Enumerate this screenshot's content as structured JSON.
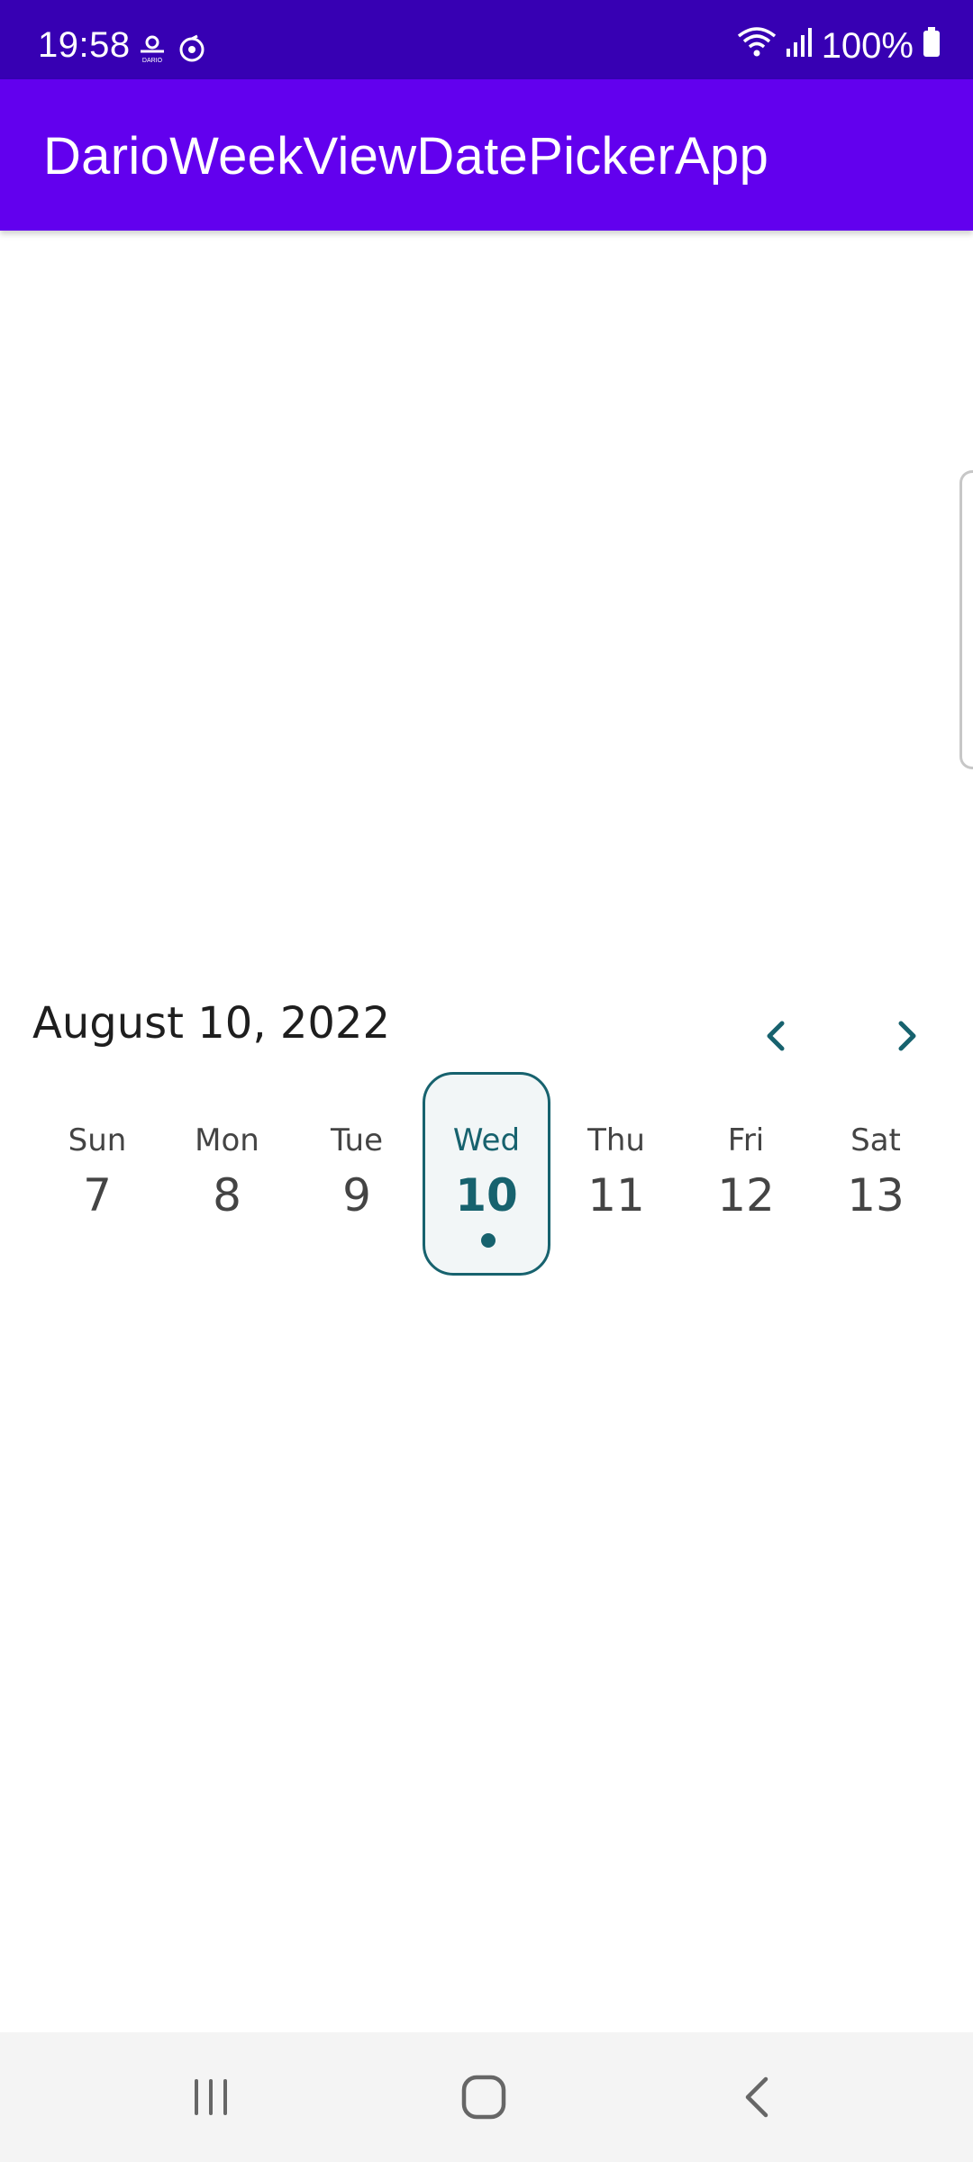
{
  "status_bar": {
    "time": "19:58",
    "notification_icons": [
      "dario-app-icon",
      "sync-icon"
    ],
    "battery_text": "100%",
    "right_icons": [
      "wifi-icon",
      "signal-icon",
      "battery-icon"
    ]
  },
  "app_bar": {
    "title": "DarioWeekViewDatePickerApp"
  },
  "week_picker": {
    "selected_date_label": "August 10, 2022",
    "prev_icon": "chevron-left-icon",
    "next_icon": "chevron-right-icon",
    "accent_color": "#17626e",
    "days": [
      {
        "name": "Sun",
        "number": "7",
        "selected": false
      },
      {
        "name": "Mon",
        "number": "8",
        "selected": false
      },
      {
        "name": "Tue",
        "number": "9",
        "selected": false
      },
      {
        "name": "Wed",
        "number": "10",
        "selected": true,
        "has_event": true
      },
      {
        "name": "Thu",
        "number": "11",
        "selected": false
      },
      {
        "name": "Fri",
        "number": "12",
        "selected": false
      },
      {
        "name": "Sat",
        "number": "13",
        "selected": false
      }
    ]
  },
  "nav_bar": {
    "keys": [
      "recents-icon",
      "home-icon",
      "back-icon"
    ]
  },
  "colors": {
    "status_bar": "#3700B3",
    "app_bar": "#6200EE"
  }
}
